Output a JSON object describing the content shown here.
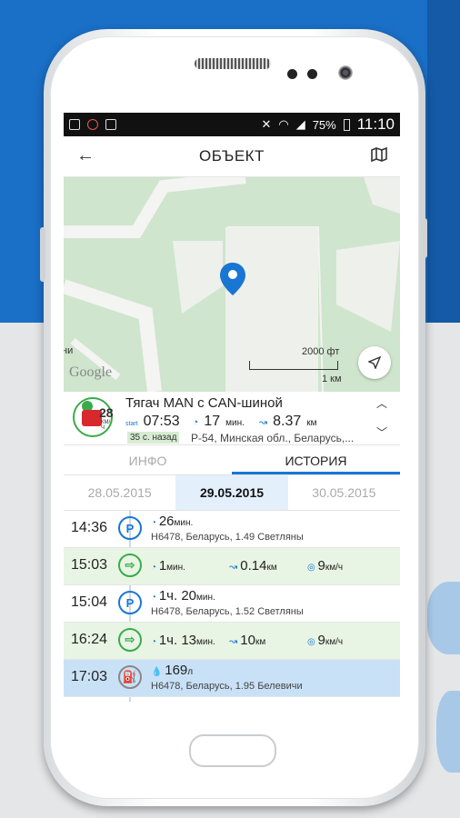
{
  "status_bar": {
    "battery": "75%",
    "time": "11:10"
  },
  "header": {
    "title": "ОБЪЕКТ"
  },
  "map": {
    "scale_ft": "2000 фт",
    "scale_km": "1 км",
    "attribution": "Google",
    "edge_text": "ни"
  },
  "object": {
    "name": "Тягач MAN с CAN-шиной",
    "speed": "28",
    "speed_unit": "КМ/Ч",
    "start_label": "start",
    "start_time": "07:53",
    "duration": "17",
    "duration_unit": "мин.",
    "distance": "8.37",
    "distance_unit": "км",
    "ago": "35 с. назад",
    "address": "Р-54, Минская обл., Беларусь,..."
  },
  "tabs": [
    "ИНФО",
    "ИСТОРИЯ"
  ],
  "dates": [
    "28.05.2015",
    "29.05.2015",
    "30.05.2015"
  ],
  "history": [
    {
      "time": "14:36",
      "type": "parking",
      "icon": "P",
      "value": "26",
      "unit": "мин.",
      "address": "Н6478, Беларусь, 1.49  Светляны"
    },
    {
      "time": "15:03",
      "type": "move",
      "duration": "1",
      "duration_unit": "мин.",
      "distance": "0.14",
      "distance_unit": "км",
      "speed": "9",
      "speed_unit": "км/ч"
    },
    {
      "time": "15:04",
      "type": "parking",
      "icon": "P",
      "value": "1ч. 20",
      "unit": "мин.",
      "address": "Н6478, Беларусь, 1.52  Светляны"
    },
    {
      "time": "16:24",
      "type": "move",
      "duration": "1ч. 13",
      "duration_unit": "мин.",
      "distance": "10",
      "distance_unit": "км",
      "speed": "9",
      "speed_unit": "км/ч"
    },
    {
      "time": "17:03",
      "type": "fuel",
      "value": "169",
      "unit": "л",
      "address": "Н6478, Беларусь, 1.95  Белевичи"
    }
  ],
  "colors": {
    "accent": "#1976d2",
    "green": "#3aab4a",
    "bg_blue": "#1a6fc6"
  }
}
